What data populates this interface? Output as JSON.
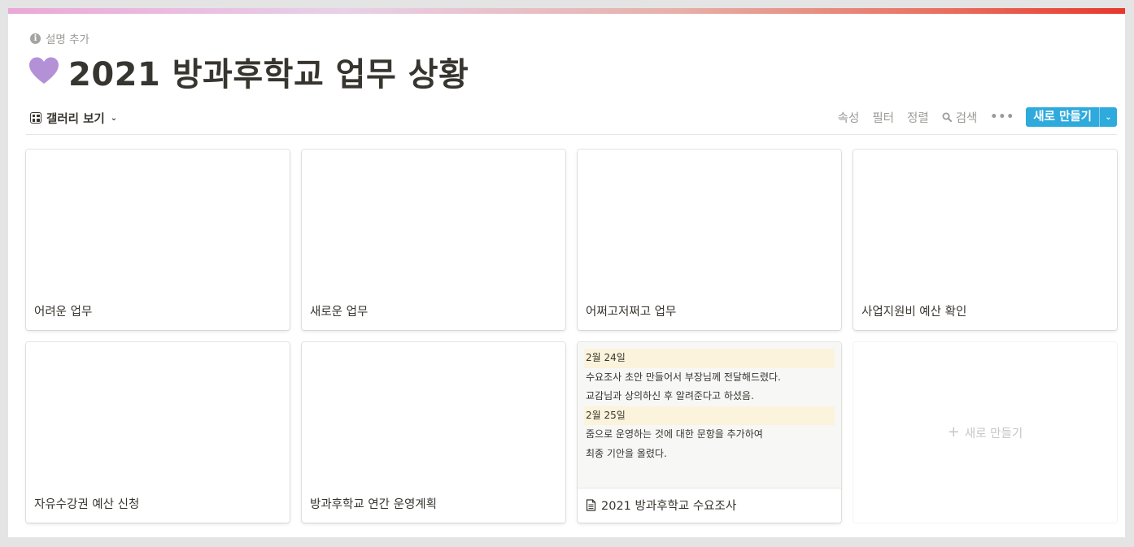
{
  "page": {
    "description": "설명 추가",
    "title": "2021 방과후학교 업무 상황",
    "emoji": "purple-heart-icon",
    "accent_color": "#2eaadc",
    "heart_color": "#b491d7"
  },
  "toolbar": {
    "view_label": "갤러리 보기",
    "properties": "속성",
    "filter": "필터",
    "sort": "정렬",
    "search": "검색",
    "more": "•••",
    "new_label": "새로 만들기"
  },
  "cards": [
    {
      "title": "어려운 업무"
    },
    {
      "title": "새로운 업무"
    },
    {
      "title": "어쩌고저쩌고 업무"
    },
    {
      "title": "사업지원비 예산 확인"
    },
    {
      "title": "자유수강권 예산 신청"
    },
    {
      "title": "방과후학교 연간 운영계획"
    },
    {
      "title": "2021 방과후학교 수요조사",
      "preview": [
        {
          "text": "2월 24일",
          "highlight": true
        },
        {
          "text": "수요조사 초안 만들어서 부장님께 전달해드렸다.",
          "highlight": false
        },
        {
          "text": "교감님과 상의하신 후 알려준다고 하셨음.",
          "highlight": false
        },
        {
          "text": "2월 25일",
          "highlight": true
        },
        {
          "text": "줌으로 운영하는 것에 대한 문항을 추가하여",
          "highlight": false
        },
        {
          "text": "최종 기안을 올렸다.",
          "highlight": false
        }
      ]
    }
  ],
  "add_card": {
    "label": "새로 만들기"
  }
}
